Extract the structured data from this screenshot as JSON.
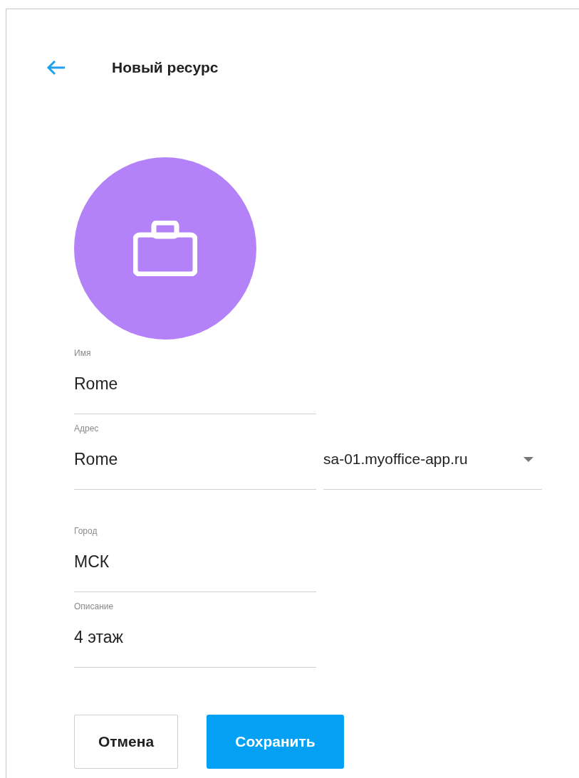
{
  "header": {
    "title": "Новый ресурс"
  },
  "sections": [
    {
      "fields": [
        {
          "label": "Имя",
          "value": "Rome"
        },
        {
          "label": "Адрес",
          "value": "Rome",
          "domain": "sa-01.myoffice-app.ru"
        }
      ]
    },
    {
      "fields": [
        {
          "label": "Город",
          "value": "МСК"
        },
        {
          "label": "Описание",
          "value": "4 этаж"
        }
      ]
    }
  ],
  "buttons": [
    {
      "label": "Отмена",
      "kind": "secondary"
    },
    {
      "label": "Сохранить",
      "kind": "primary"
    }
  ]
}
